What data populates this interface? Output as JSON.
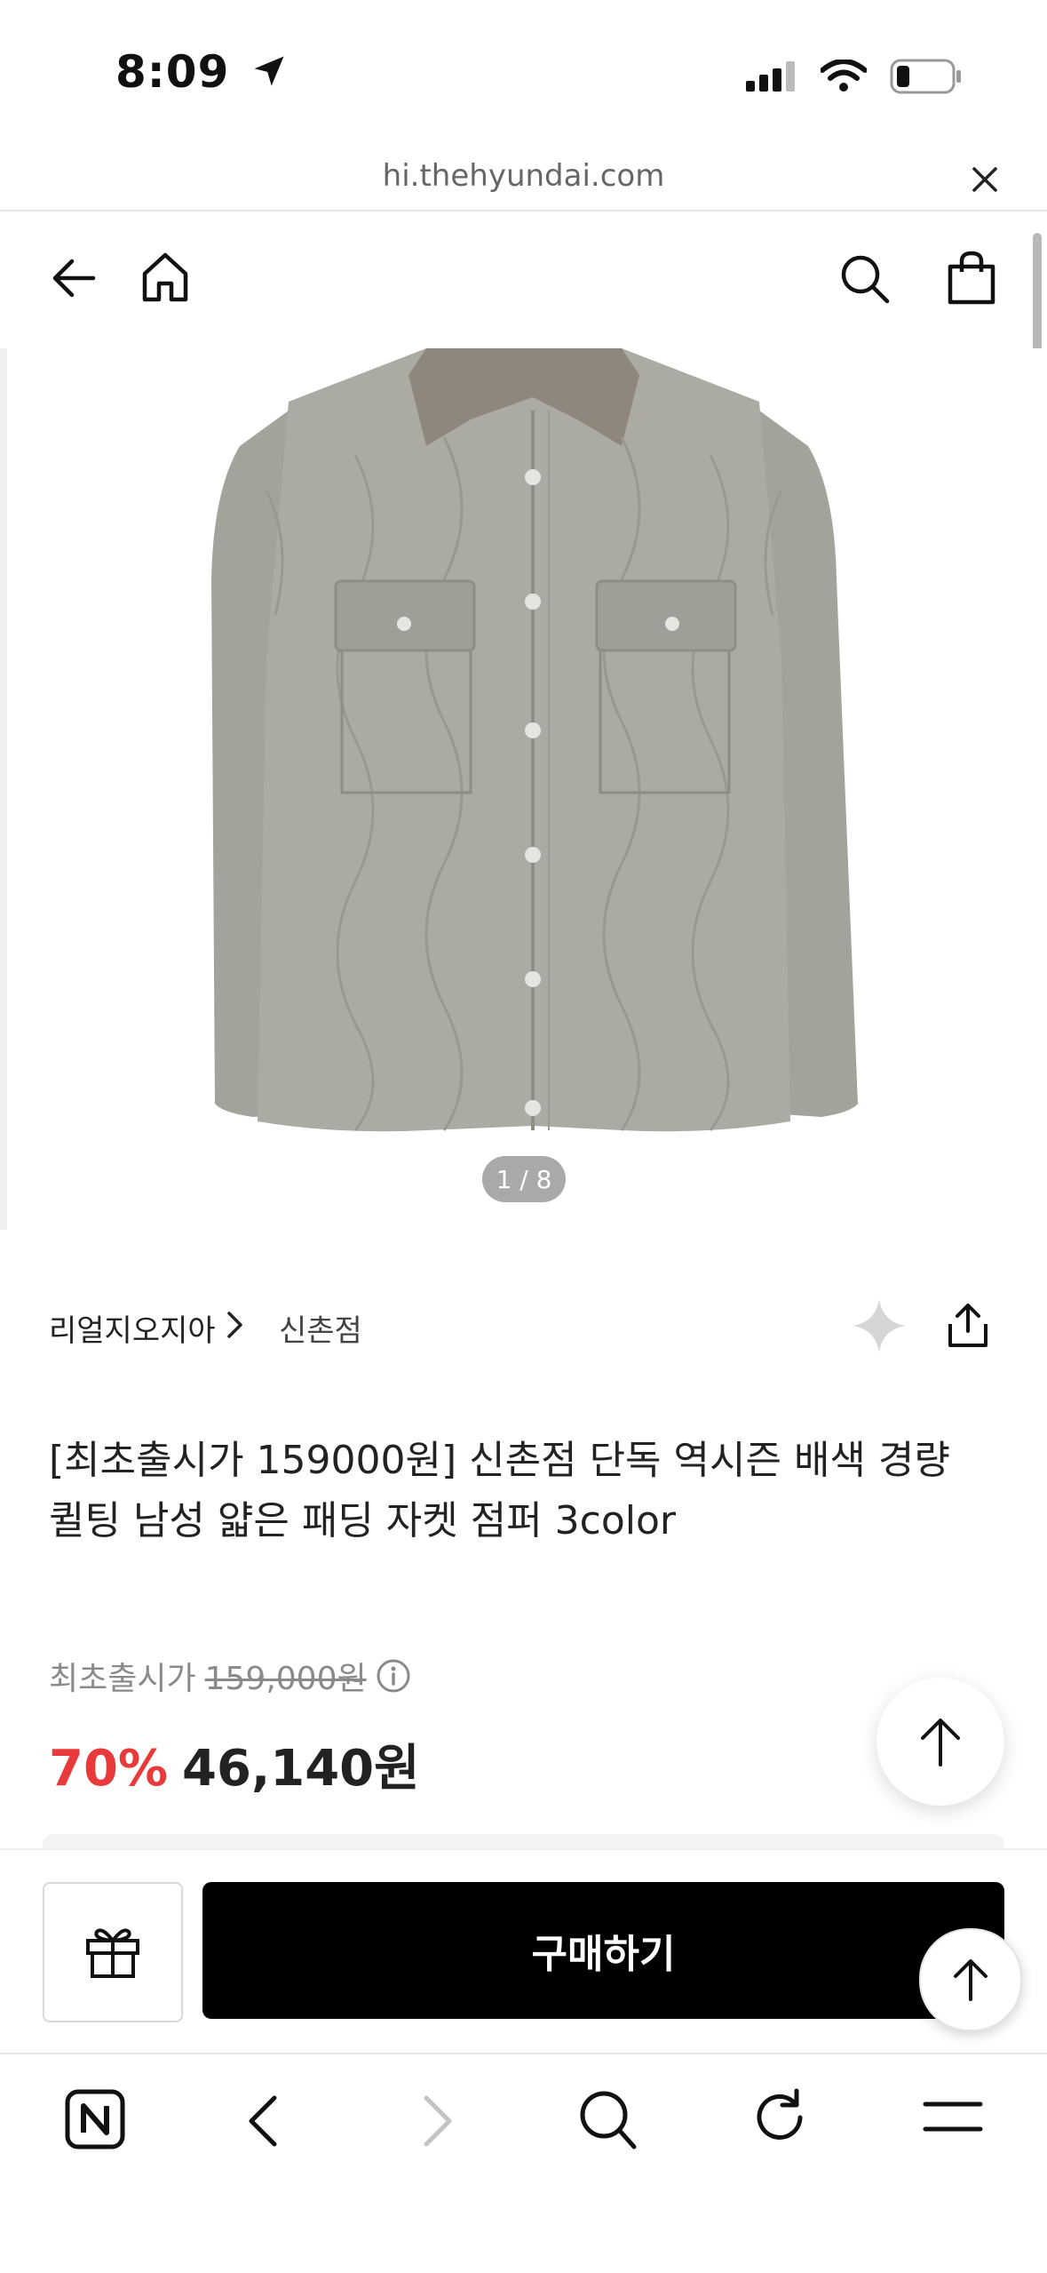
{
  "status_bar": {
    "time": "8:09"
  },
  "browser": {
    "url": "hi.thehyundai.com"
  },
  "gallery": {
    "counter": "1 / 8"
  },
  "product": {
    "brand": "리얼지오지아",
    "store": "신촌점",
    "title": "[최초출시가 159000원] 신촌점 단독 역시즌 배색 경량 퀼팅 남성 얇은 패딩 자켓 점퍼 3color",
    "original_label": "최초출시가",
    "original_price": "159,000원",
    "discount": "70%",
    "price": "46,140원"
  },
  "actions": {
    "buy_label": "구매하기"
  },
  "colors": {
    "discount": "#e83a3a",
    "buy_button": "#000000",
    "jacket": "#a9a89f",
    "collar": "#8f877c"
  },
  "icons": [
    "location-arrow-icon",
    "signal-icon",
    "wifi-icon",
    "battery-icon",
    "close-icon",
    "back-arrow-icon",
    "home-icon",
    "search-icon",
    "shopping-bag-icon",
    "chevron-right-icon",
    "sparkle-icon",
    "share-icon",
    "info-icon",
    "arrow-up-icon",
    "gift-icon",
    "naver-n-icon",
    "chevron-left-icon",
    "reload-icon",
    "menu-icon"
  ]
}
